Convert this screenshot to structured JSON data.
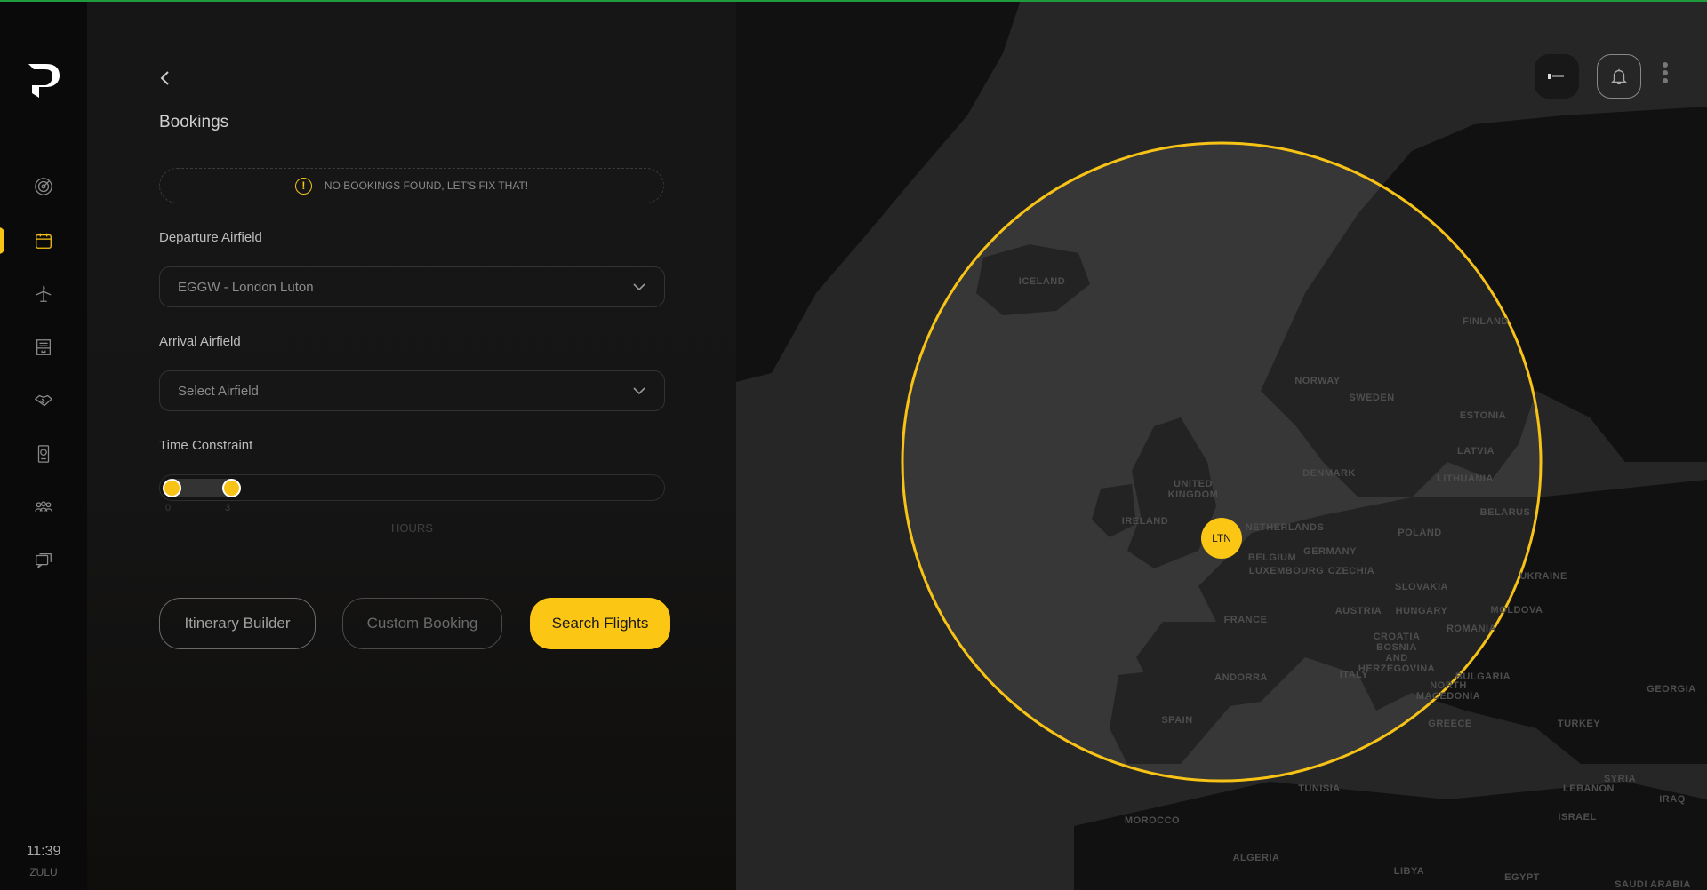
{
  "sidebar": {
    "items": [
      {
        "name": "radar",
        "icon": "radar-icon"
      },
      {
        "name": "bookings",
        "icon": "calendar-icon",
        "active": true
      },
      {
        "name": "flights",
        "icon": "airplane-icon"
      },
      {
        "name": "archive",
        "icon": "archive-icon"
      },
      {
        "name": "partners",
        "icon": "handshake-icon"
      },
      {
        "name": "passport",
        "icon": "passport-icon"
      },
      {
        "name": "team",
        "icon": "users-icon"
      },
      {
        "name": "messages",
        "icon": "chat-icon"
      }
    ],
    "time": "11:39",
    "timezone": "ZULU"
  },
  "panel": {
    "title": "Bookings",
    "notice": "NO BOOKINGS FOUND, LET'S FIX THAT!",
    "departure": {
      "label": "Departure Airfield",
      "value": "EGGW - London Luton"
    },
    "arrival": {
      "label": "Arrival Airfield",
      "placeholder": "Select Airfield"
    },
    "time_constraint": {
      "label": "Time Constraint",
      "min": "0",
      "max": "3",
      "unit": "HOURS",
      "range_hours": [
        0,
        3
      ]
    },
    "buttons": {
      "itinerary": "Itinerary Builder",
      "custom": "Custom Booking",
      "search": "Search Flights"
    }
  },
  "map": {
    "marker": "LTN",
    "accent": "#fbc614",
    "labels": [
      "ICELAND",
      "NORWAY",
      "SWEDEN",
      "FINLAND",
      "ESTONIA",
      "LATVIA",
      "LITHUANIA",
      "BELARUS",
      "DENMARK",
      "UNITED\nKINGDOM",
      "IRELAND",
      "NETHERLANDS",
      "GERMANY",
      "BELGIUM",
      "LUXEMBOURG",
      "POLAND",
      "CZECHIA",
      "SLOVAKIA",
      "UKRAINE",
      "AUSTRIA",
      "HUNGARY",
      "MOLDOVA",
      "ROMANIA",
      "FRANCE",
      "CROATIA\nBOSNIA\nAND\nHERZEGOVINA",
      "ITALY",
      "BULGARIA",
      "NORTH\nMACEDONIA",
      "ANDORRA",
      "SPAIN",
      "GREECE",
      "TURKEY",
      "GEORGIA",
      "SYRIA",
      "LEBANON",
      "IRAQ",
      "ISRAEL",
      "MOROCCO",
      "ALGERIA",
      "TUNISIA",
      "LIBYA",
      "EGYPT",
      "SAUDI ARABIA"
    ]
  }
}
